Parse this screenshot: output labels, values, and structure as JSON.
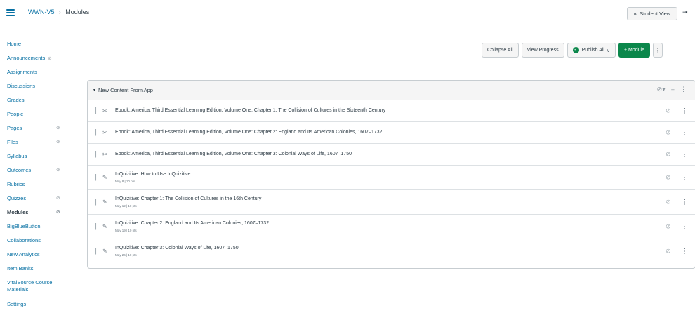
{
  "header": {
    "course": "WWN-V5",
    "separator": "›",
    "page": "Modules",
    "student_view": "Student View",
    "student_view_icon": "glasses-icon",
    "collapse_icon": "collapse-nav-icon"
  },
  "nav": {
    "items": [
      {
        "label": "Home"
      },
      {
        "label": "Announcements",
        "hidden": true
      },
      {
        "label": "Assignments"
      },
      {
        "label": "Discussions"
      },
      {
        "label": "Grades"
      },
      {
        "label": "People"
      },
      {
        "label": "Pages",
        "hidden": true
      },
      {
        "label": "Files",
        "hidden": true
      },
      {
        "label": "Syllabus"
      },
      {
        "label": "Outcomes",
        "hidden": true
      },
      {
        "label": "Rubrics"
      },
      {
        "label": "Quizzes",
        "hidden": true
      },
      {
        "label": "Modules",
        "hidden": true,
        "active": true
      },
      {
        "label": "BigBlueButton"
      },
      {
        "label": "Collaborations"
      },
      {
        "label": "New Analytics"
      },
      {
        "label": "Item Banks"
      },
      {
        "label": "VitalSource Course Materials"
      },
      {
        "label": "Settings"
      }
    ]
  },
  "toolbar": {
    "collapse_all": "Collapse All",
    "view_progress": "View Progress",
    "publish_all": "Publish All",
    "add_module": "+ Module"
  },
  "colors": {
    "accent": "#0770a3",
    "success": "#0b874b",
    "text": "#2d3b45"
  },
  "module": {
    "title": "New Content From App",
    "items": [
      {
        "type": "link",
        "title": "Ebook: America, Third Essential Learning Edition, Volume One: Chapter 1: The Collision of Cultures in the Sixteenth Century",
        "meta": ""
      },
      {
        "type": "link",
        "title": "Ebook: America, Third Essential Learning Edition, Volume One: Chapter 2: England and Its American Colonies, 1607–1732",
        "meta": ""
      },
      {
        "type": "link",
        "title": "Ebook: America, Third Essential Learning Edition, Volume One: Chapter 3: Colonial Ways of Life, 1607–1750",
        "meta": ""
      },
      {
        "type": "assignment",
        "title": "InQuizitive: How to Use InQuizitive",
        "meta": "May 8 | 10 pts"
      },
      {
        "type": "assignment",
        "title": "InQuizitive: Chapter 1: The Collision of Cultures in the 16th Century",
        "meta": "May 12 | 10 pts"
      },
      {
        "type": "assignment",
        "title": "InQuizitive: Chapter 2: England and Its American Colonies, 1607–1732",
        "meta": "May 19 | 10 pts"
      },
      {
        "type": "assignment",
        "title": "InQuizitive: Chapter 3: Colonial Ways of Life, 1607–1750",
        "meta": "May 26 | 10 pts"
      }
    ]
  }
}
